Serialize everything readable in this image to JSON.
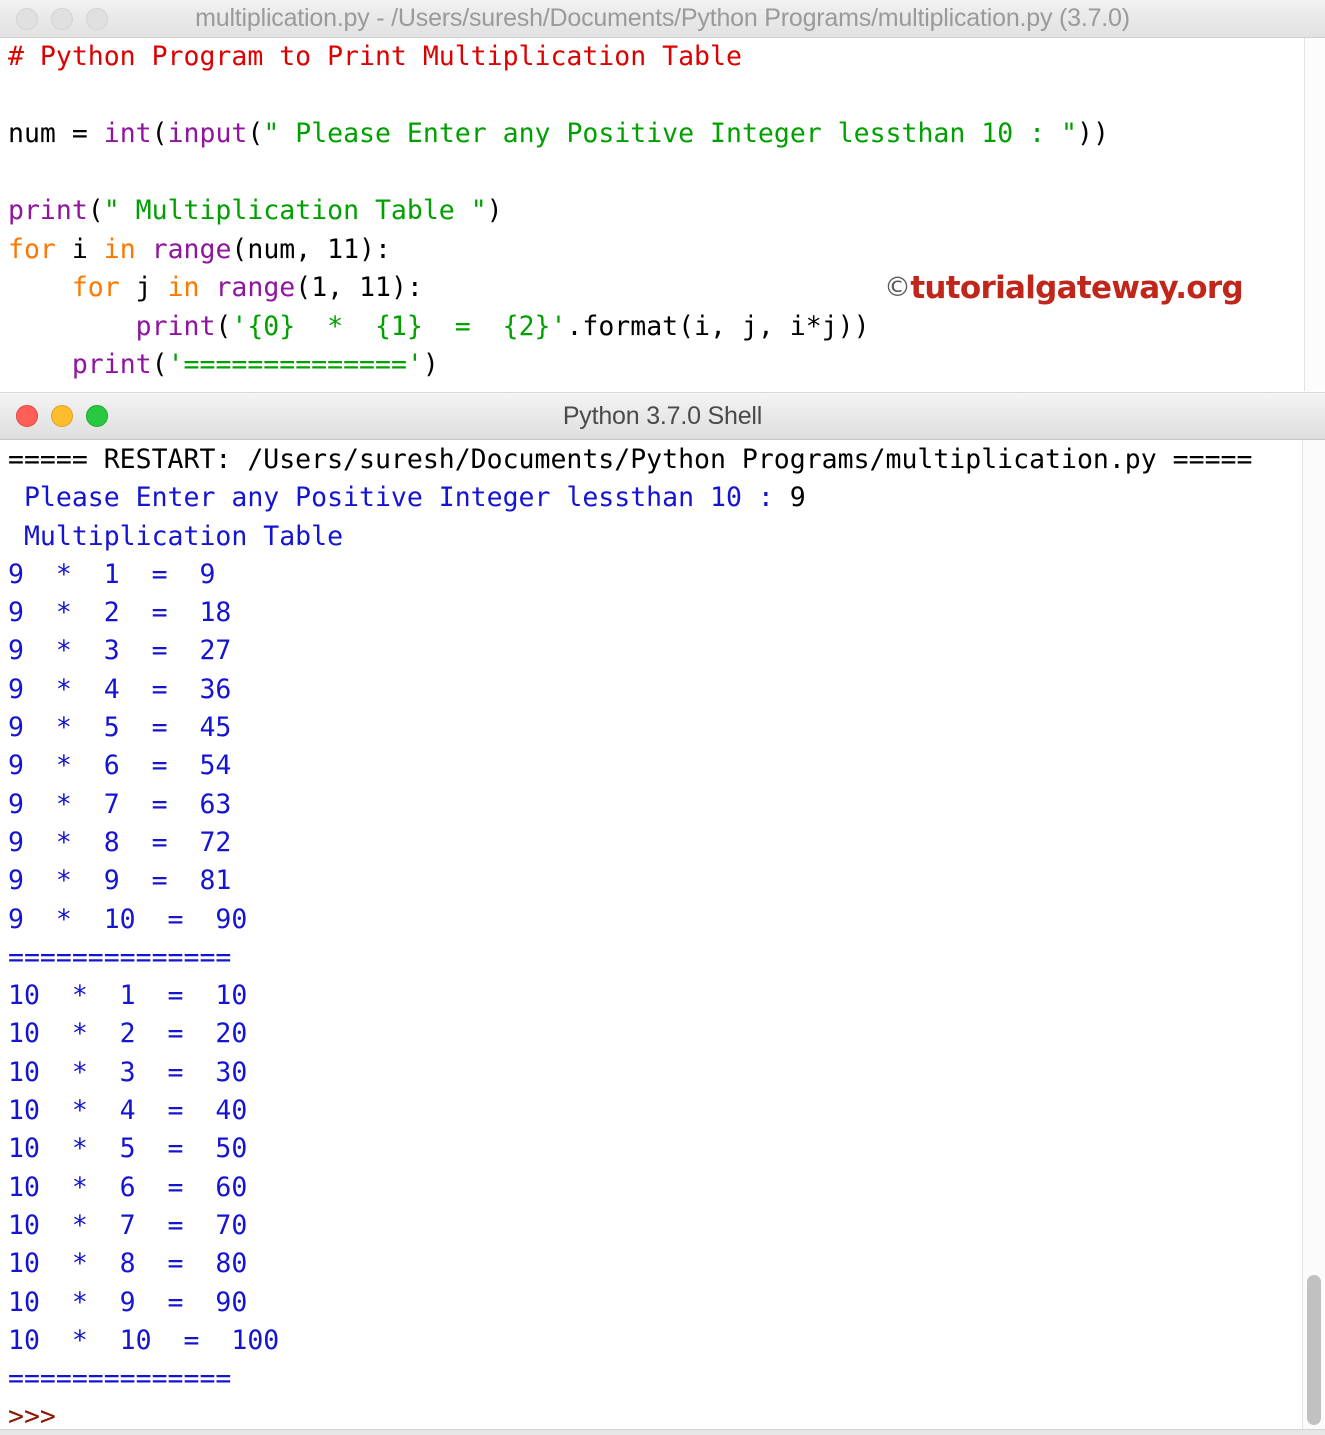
{
  "editor": {
    "title": "multiplication.py - /Users/suresh/Documents/Python Programs/multiplication.py (3.7.0)",
    "window_active": false,
    "traffic_lights": [
      "close-dot",
      "minimize-dot",
      "zoom-dot"
    ],
    "watermark": {
      "copyright_symbol": "©",
      "text": "tutorialgateway.org",
      "color": "#c0261a"
    },
    "syntax_colors": {
      "comment": "#dd0000",
      "builtin": "#9014a0",
      "string": "#00a000",
      "keyword": "#ff7700",
      "plain": "#000000"
    },
    "code_lines": [
      {
        "tokens": [
          {
            "t": "# Python Program to Print Multiplication Table",
            "c": "comment"
          }
        ]
      },
      {
        "tokens": [
          {
            "t": "",
            "c": "plain"
          }
        ]
      },
      {
        "tokens": [
          {
            "t": "num = ",
            "c": "plain"
          },
          {
            "t": "int",
            "c": "builtin"
          },
          {
            "t": "(",
            "c": "plain"
          },
          {
            "t": "input",
            "c": "builtin"
          },
          {
            "t": "(",
            "c": "plain"
          },
          {
            "t": "\" Please Enter any Positive Integer lessthan 10 : \"",
            "c": "string"
          },
          {
            "t": "))",
            "c": "plain"
          }
        ]
      },
      {
        "tokens": [
          {
            "t": "",
            "c": "plain"
          }
        ]
      },
      {
        "tokens": [
          {
            "t": "print",
            "c": "builtin"
          },
          {
            "t": "(",
            "c": "plain"
          },
          {
            "t": "\" Multiplication Table \"",
            "c": "string"
          },
          {
            "t": ")",
            "c": "plain"
          }
        ]
      },
      {
        "tokens": [
          {
            "t": "for",
            "c": "keyword"
          },
          {
            "t": " i ",
            "c": "plain"
          },
          {
            "t": "in",
            "c": "keyword"
          },
          {
            "t": " ",
            "c": "plain"
          },
          {
            "t": "range",
            "c": "builtin"
          },
          {
            "t": "(num, 11):",
            "c": "plain"
          }
        ]
      },
      {
        "tokens": [
          {
            "t": "    ",
            "c": "plain"
          },
          {
            "t": "for",
            "c": "keyword"
          },
          {
            "t": " j ",
            "c": "plain"
          },
          {
            "t": "in",
            "c": "keyword"
          },
          {
            "t": " ",
            "c": "plain"
          },
          {
            "t": "range",
            "c": "builtin"
          },
          {
            "t": "(1, 11):",
            "c": "plain"
          }
        ]
      },
      {
        "tokens": [
          {
            "t": "        ",
            "c": "plain"
          },
          {
            "t": "print",
            "c": "builtin"
          },
          {
            "t": "(",
            "c": "plain"
          },
          {
            "t": "'{0}  *  {1}  =  {2}'",
            "c": "string"
          },
          {
            "t": ".format(i, j, i*j))",
            "c": "plain"
          }
        ]
      },
      {
        "tokens": [
          {
            "t": "    ",
            "c": "plain"
          },
          {
            "t": "print",
            "c": "builtin"
          },
          {
            "t": "(",
            "c": "plain"
          },
          {
            "t": "'=============='",
            "c": "string"
          },
          {
            "t": ")",
            "c": "plain"
          }
        ]
      }
    ]
  },
  "shell": {
    "title": "Python 3.7.0 Shell",
    "window_active": true,
    "traffic_lights": [
      "close-dot",
      "minimize-dot",
      "zoom-dot"
    ],
    "restart_line": "===== RESTART: /Users/suresh/Documents/Python Programs/multiplication.py =====",
    "prompt_line": " Please Enter any Positive Integer lessthan 10 : ",
    "user_input": "9",
    "table_header": " Multiplication Table",
    "separator": "==============",
    "final_prompt": ">>>",
    "colors": {
      "restart": "#000000",
      "output": "#1414d2",
      "user_input": "#000000",
      "prompt": "#8b1a00"
    },
    "output_blocks": [
      {
        "multiplier": "9",
        "rows": [
          "9  *  1  =  9",
          "9  *  2  =  18",
          "9  *  3  =  27",
          "9  *  4  =  36",
          "9  *  5  =  45",
          "9  *  6  =  54",
          "9  *  7  =  63",
          "9  *  8  =  72",
          "9  *  9  =  81",
          "9  *  10  =  90"
        ]
      },
      {
        "multiplier": "10",
        "rows": [
          "10  *  1  =  10",
          "10  *  2  =  20",
          "10  *  3  =  30",
          "10  *  4  =  40",
          "10  *  5  =  50",
          "10  *  6  =  60",
          "10  *  7  =  70",
          "10  *  8  =  80",
          "10  *  9  =  90",
          "10  *  10  =  100"
        ]
      }
    ]
  }
}
